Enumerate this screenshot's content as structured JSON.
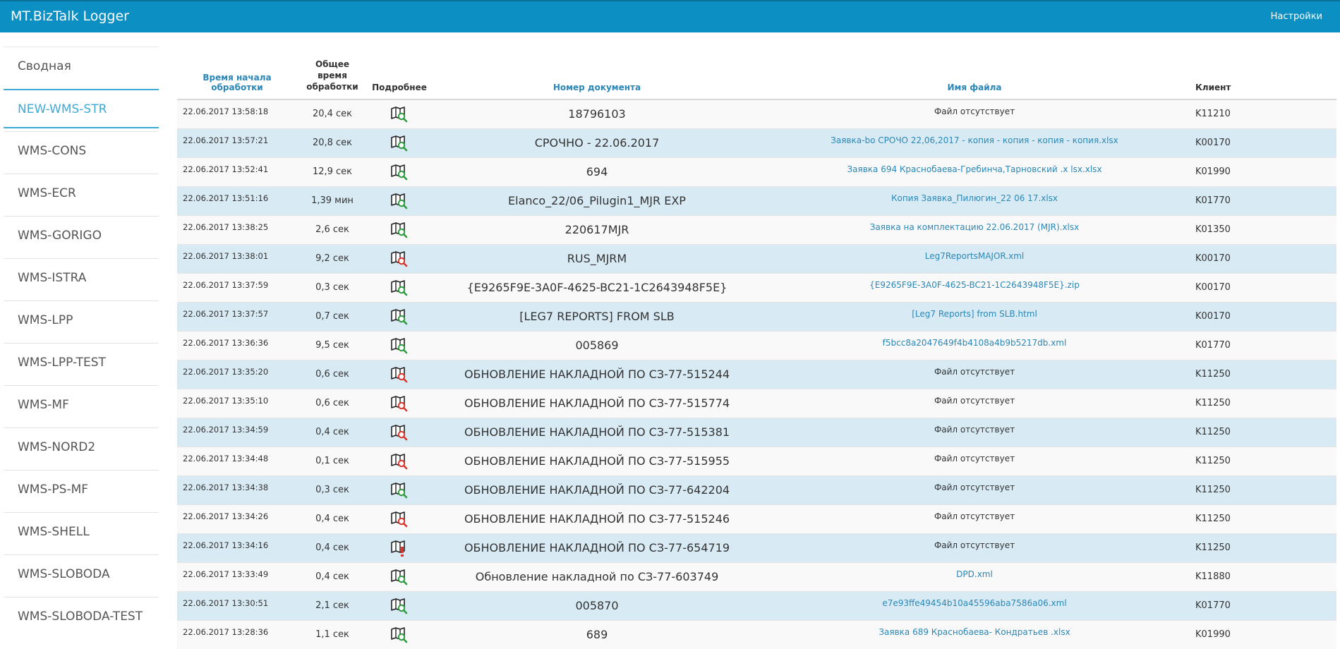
{
  "header": {
    "title": "MT.BizTalk Logger",
    "settings_label": "Настройки"
  },
  "sidebar": {
    "items": [
      {
        "label": "Сводная",
        "active": false
      },
      {
        "label": "NEW-WMS-STR",
        "active": true
      },
      {
        "label": "WMS-CONS",
        "active": false
      },
      {
        "label": "WMS-ECR",
        "active": false
      },
      {
        "label": "WMS-GORIGO",
        "active": false
      },
      {
        "label": "WMS-ISTRA",
        "active": false
      },
      {
        "label": "WMS-LPP",
        "active": false
      },
      {
        "label": "WMS-LPP-TEST",
        "active": false
      },
      {
        "label": "WMS-MF",
        "active": false
      },
      {
        "label": "WMS-NORD2",
        "active": false
      },
      {
        "label": "WMS-PS-MF",
        "active": false
      },
      {
        "label": "WMS-SHELL",
        "active": false
      },
      {
        "label": "WMS-SLOBODA",
        "active": false
      },
      {
        "label": "WMS-SLOBODA-TEST",
        "active": false
      }
    ]
  },
  "table": {
    "headers": {
      "start_time": "Время начала обработки",
      "total_time_line1": "Общее",
      "total_time_line2": "время",
      "total_time_line3": "обработки",
      "details": "Подробнее",
      "doc_number": "Номер документа",
      "file_name": "Имя файла",
      "client": "Клиент"
    },
    "status_colors": {
      "success": "#2e9a3e",
      "error": "#d9342b"
    },
    "rows": [
      {
        "time": "22.06.2017 13:58:18",
        "duration": "20,4 сек",
        "status": "success",
        "doc": "18796103",
        "file": "Файл отсутствует",
        "has_file": false,
        "client": "K11210"
      },
      {
        "time": "22.06.2017 13:57:21",
        "duration": "20,8 сек",
        "status": "success",
        "doc": "СРОЧНО - 22.06.2017",
        "file": "Заявка-bo СРОЧО 22,06,2017 - копия - копия - копия - копия.xlsx",
        "has_file": true,
        "client": "K00170"
      },
      {
        "time": "22.06.2017 13:52:41",
        "duration": "12,9 сек",
        "status": "success",
        "doc": "694",
        "file": "Заявка 694 Краснобаева-Гребинча,Тарновский .x lsx.xlsx",
        "has_file": true,
        "client": "K01990"
      },
      {
        "time": "22.06.2017 13:51:16",
        "duration": "1,39 мин",
        "status": "success",
        "doc": "Elanco_22/06_Pilugin1_MJR EXP",
        "file": "Копия Заявка_Пилюгин_22 06 17.xlsx",
        "has_file": true,
        "client": "K01770"
      },
      {
        "time": "22.06.2017 13:38:25",
        "duration": "2,6 сек",
        "status": "success",
        "doc": "220617MJR",
        "file": "Заявка на комплектацию 22.06.2017 (MJR).xlsx",
        "has_file": true,
        "client": "K01350"
      },
      {
        "time": "22.06.2017 13:38:01",
        "duration": "9,2 сек",
        "status": "error",
        "doc": "RUS_MJRM",
        "file": "Leg7ReportsMAJOR.xml",
        "has_file": true,
        "client": "K00170"
      },
      {
        "time": "22.06.2017 13:37:59",
        "duration": "0,3 сек",
        "status": "success",
        "doc": "{E9265F9E-3A0F-4625-BC21-1C2643948F5E}",
        "file": "{E9265F9E-3A0F-4625-BC21-1C2643948F5E}.zip",
        "has_file": true,
        "client": "K00170"
      },
      {
        "time": "22.06.2017 13:37:57",
        "duration": "0,7 сек",
        "status": "success",
        "doc": "[LEG7 REPORTS] FROM SLB",
        "file": "[Leg7 Reports] from SLB.html",
        "has_file": true,
        "client": "K00170"
      },
      {
        "time": "22.06.2017 13:36:36",
        "duration": "9,5 сек",
        "status": "success",
        "doc": "005869",
        "file": "f5bcc8a2047649f4b4108a4b9b5217db.xml",
        "has_file": true,
        "client": "K01770"
      },
      {
        "time": "22.06.2017 13:35:20",
        "duration": "0,6 сек",
        "status": "error",
        "doc": "ОБНОВЛЕНИЕ НАКЛАДНОЙ ПО СЗ-77-515244",
        "file": "Файл отсутствует",
        "has_file": false,
        "client": "K11250"
      },
      {
        "time": "22.06.2017 13:35:10",
        "duration": "0,6 сек",
        "status": "error",
        "doc": "ОБНОВЛЕНИЕ НАКЛАДНОЙ ПО СЗ-77-515774",
        "file": "Файл отсутствует",
        "has_file": false,
        "client": "K11250"
      },
      {
        "time": "22.06.2017 13:34:59",
        "duration": "0,4 сек",
        "status": "error",
        "doc": "ОБНОВЛЕНИЕ НАКЛАДНОЙ ПО СЗ-77-515381",
        "file": "Файл отсутствует",
        "has_file": false,
        "client": "K11250"
      },
      {
        "time": "22.06.2017 13:34:48",
        "duration": "0,1 сек",
        "status": "error",
        "doc": "ОБНОВЛЕНИЕ НАКЛАДНОЙ ПО СЗ-77-515955",
        "file": "Файл отсутствует",
        "has_file": false,
        "client": "K11250"
      },
      {
        "time": "22.06.2017 13:34:38",
        "duration": "0,3 сек",
        "status": "success",
        "doc": "ОБНОВЛЕНИЕ НАКЛАДНОЙ ПО СЗ-77-642204",
        "file": "Файл отсутствует",
        "has_file": false,
        "client": "K11250"
      },
      {
        "time": "22.06.2017 13:34:26",
        "duration": "0,4 сек",
        "status": "error",
        "doc": "ОБНОВЛЕНИЕ НАКЛАДНОЙ ПО СЗ-77-515246",
        "file": "Файл отсутствует",
        "has_file": false,
        "client": "K11250"
      },
      {
        "time": "22.06.2017 13:34:16",
        "duration": "0,4 сек",
        "status": "warning",
        "doc": "ОБНОВЛЕНИЕ НАКЛАДНОЙ ПО СЗ-77-654719",
        "file": "Файл отсутствует",
        "has_file": false,
        "client": "K11250"
      },
      {
        "time": "22.06.2017 13:33:49",
        "duration": "0,4 сек",
        "status": "success",
        "doc": "Обновление накладной по СЗ-77-603749",
        "file": "DPD.xml",
        "has_file": true,
        "client": "K11880"
      },
      {
        "time": "22.06.2017 13:30:51",
        "duration": "2,1 сек",
        "status": "success",
        "doc": "005870",
        "file": "e7e93ffe49454b10a45596aba7586a06.xml",
        "has_file": true,
        "client": "K01770"
      },
      {
        "time": "22.06.2017 13:28:36",
        "duration": "1,1 сек",
        "status": "success",
        "doc": "689",
        "file": "Заявка 689 Краснобаева- Кондратьев .xlsx",
        "has_file": true,
        "client": "K01990"
      }
    ]
  }
}
